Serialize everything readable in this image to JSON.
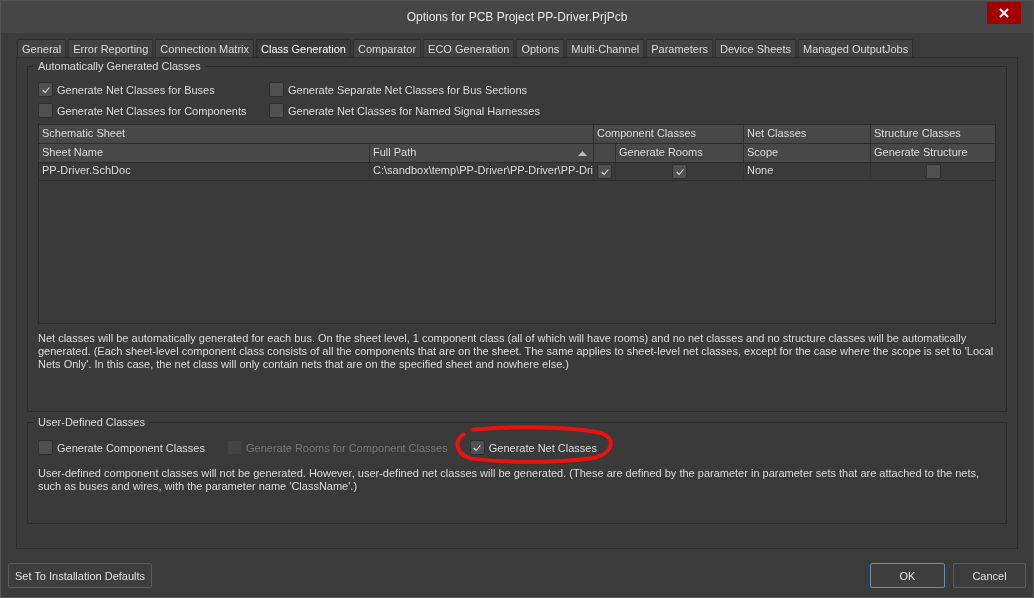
{
  "window": {
    "title": "Options for PCB Project PP-Driver.PrjPcb"
  },
  "tabs": [
    {
      "label": "General",
      "selected": false
    },
    {
      "label": "Error Reporting",
      "selected": false
    },
    {
      "label": "Connection Matrix",
      "selected": false
    },
    {
      "label": "Class Generation",
      "selected": true
    },
    {
      "label": "Comparator",
      "selected": false
    },
    {
      "label": "ECO Generation",
      "selected": false
    },
    {
      "label": "Options",
      "selected": false
    },
    {
      "label": "Multi-Channel",
      "selected": false
    },
    {
      "label": "Parameters",
      "selected": false
    },
    {
      "label": "Device Sheets",
      "selected": false
    },
    {
      "label": "Managed OutputJobs",
      "selected": false
    }
  ],
  "auto_group": {
    "title": "Automatically Generated Classes",
    "options": [
      {
        "label": "Generate Net Classes for Buses",
        "checked": true,
        "disabled": false
      },
      {
        "label": "Generate Separate Net Classes for Bus Sections",
        "checked": false,
        "disabled": false
      },
      {
        "label": "Generate Net Classes for Components",
        "checked": false,
        "disabled": false
      },
      {
        "label": "Generate Net Classes for Named Signal Harnesses",
        "checked": false,
        "disabled": false
      }
    ],
    "table": {
      "header_groups": [
        {
          "label": "Schematic Sheet"
        },
        {
          "label": "Component Classes"
        },
        {
          "label": "Net Classes"
        },
        {
          "label": "Structure Classes"
        }
      ],
      "columns": [
        {
          "label": "Sheet Name",
          "sorted": false
        },
        {
          "label": "Full Path",
          "sorted": true
        },
        {
          "label": "Generate Rooms",
          "sorted": false
        },
        {
          "label": "Scope",
          "sorted": false
        },
        {
          "label": "Generate Structure",
          "sorted": false
        }
      ],
      "rows": [
        {
          "sheet_name": "PP-Driver.SchDoc",
          "full_path": "C:\\sandbox\\temp\\PP-Driver\\PP-Driver\\PP-Dri",
          "component_classes": true,
          "generate_rooms": true,
          "scope": "None",
          "generate_structure": false
        }
      ]
    },
    "description": "Net classes will be automatically generated for each bus. On the sheet level, 1 component class (all of which will have rooms) and no net classes and no structure classes will be automatically generated. (Each sheet-level component class consists of all the components that are on the sheet. The same applies to sheet-level net classes, except for the case where the scope is set to 'Local Nets Only'. In this case, the net class will only contain nets that are on the specified sheet and nowhere else.)"
  },
  "user_group": {
    "title": "User-Defined Classes",
    "options": [
      {
        "label": "Generate Component Classes",
        "checked": false,
        "disabled": false,
        "circled": false
      },
      {
        "label": "Generate Rooms for Component Classes",
        "checked": false,
        "disabled": true,
        "circled": false
      },
      {
        "label": "Generate Net Classes",
        "checked": true,
        "disabled": false,
        "circled": true
      }
    ],
    "description": "User-defined component classes will not be generated. However, user-defined net classes will be generated. (These are defined by the parameter in parameter sets that are attached to the nets, such as buses and wires, with the parameter name 'ClassName'.)"
  },
  "buttons": {
    "defaults": "Set To Installation Defaults",
    "ok": "OK",
    "cancel": "Cancel"
  }
}
